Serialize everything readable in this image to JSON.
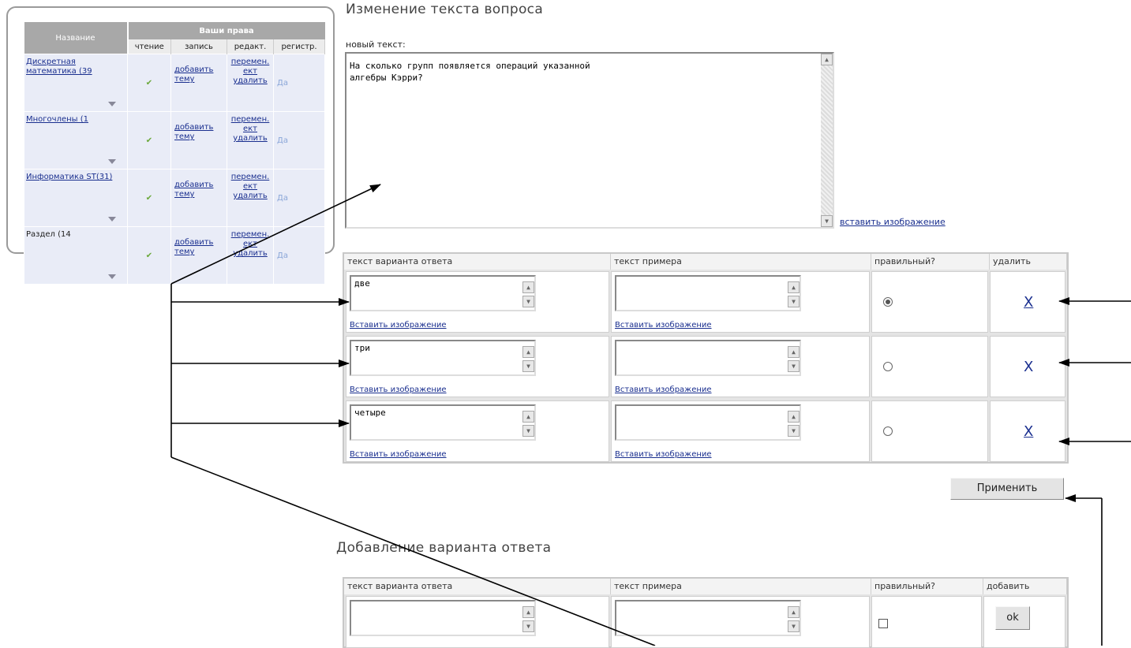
{
  "rights_panel": {
    "col_name": "Название",
    "col_group": "Ваши права",
    "sub_cols": [
      "чтение",
      "запись",
      "редакт.",
      "регистр."
    ],
    "courses": [
      {
        "name": "Дискретная математика (39",
        "write": "добавить тему",
        "edit": [
          "перемен.",
          "ект",
          "удалить"
        ],
        "reg": "Да"
      },
      {
        "name": "Многочлены (1",
        "write": "добавить тему",
        "edit": [
          "перемен.",
          "ект",
          "удалить"
        ],
        "reg": "Да"
      },
      {
        "name": "Информатика ST(31)",
        "write": "добавить тему",
        "edit": [
          "перемен.",
          "ект",
          "удалить"
        ],
        "reg": "Да"
      },
      {
        "name": "Раздел (14",
        "write": "добавить тему",
        "edit": [
          "перемен.",
          "ект",
          "удалить"
        ],
        "reg": "Да"
      }
    ]
  },
  "question": {
    "heading": "Изменение текста вопроса",
    "new_text_label": "новый текст:",
    "text": "На сколько групп появляется операций указанной\nалгебры Кэрри?",
    "insert_image": "вставить изображение"
  },
  "answers": {
    "headers": [
      "текст варианта ответа",
      "текст примера",
      "правильный?",
      "удалить"
    ],
    "insert_image": "Вставить изображение",
    "rows": [
      {
        "answer": "две",
        "example": "",
        "correct": true,
        "delete": "X"
      },
      {
        "answer": "три",
        "example": "",
        "correct": false,
        "delete": "X"
      },
      {
        "answer": "четыре",
        "example": "",
        "correct": false,
        "delete": "X"
      }
    ],
    "apply_button": "Применить"
  },
  "add_answer": {
    "heading": "Добавление варианта ответа",
    "headers": [
      "текст варианта ответа",
      "текст примера",
      "правильный?",
      "добавить"
    ],
    "ok_button": "ok"
  }
}
